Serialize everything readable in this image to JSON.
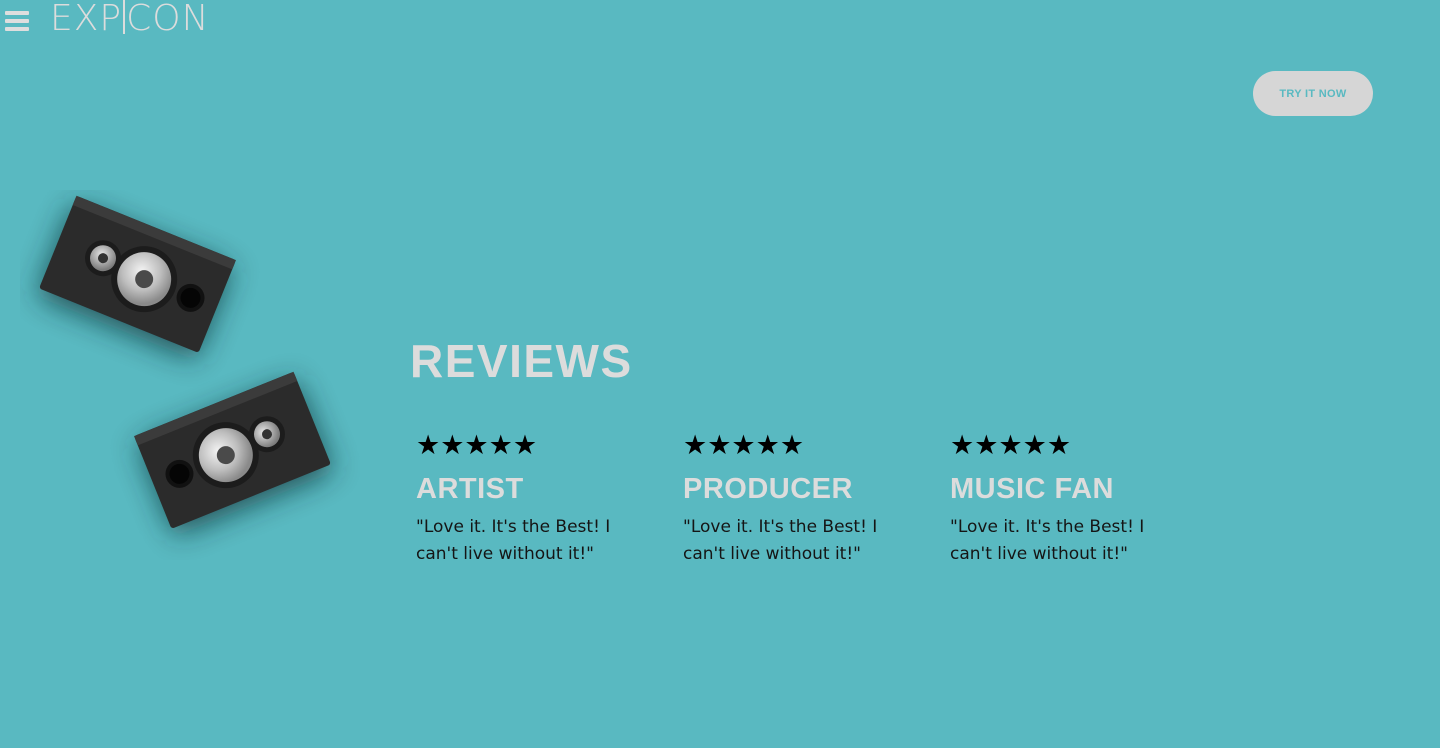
{
  "header": {
    "logo_left": "EXP",
    "logo_right": "CON",
    "menu_icon": "hamburger-icon"
  },
  "cta": {
    "label": "TRY IT NOW"
  },
  "hero": {
    "image": "speakers-image"
  },
  "reviews": {
    "title": "REVIEWS",
    "items": [
      {
        "rating": 5,
        "stars": "★★★★★",
        "role": "ARTIST",
        "quote": "\"Love it. It's the Best! I can't live without it!\""
      },
      {
        "rating": 5,
        "stars": "★★★★★",
        "role": "PRODUCER",
        "quote": "\"Love it. It's the Best! I can't live without it!\""
      },
      {
        "rating": 5,
        "stars": "★★★★★",
        "role": "MUSIC FAN",
        "quote": "\"Love it. It's the Best! I can't live without it!\""
      }
    ]
  },
  "colors": {
    "background": "#59b9c1",
    "heading": "#dcdcdc",
    "button": "#d6d6d6",
    "text": "#151515"
  }
}
